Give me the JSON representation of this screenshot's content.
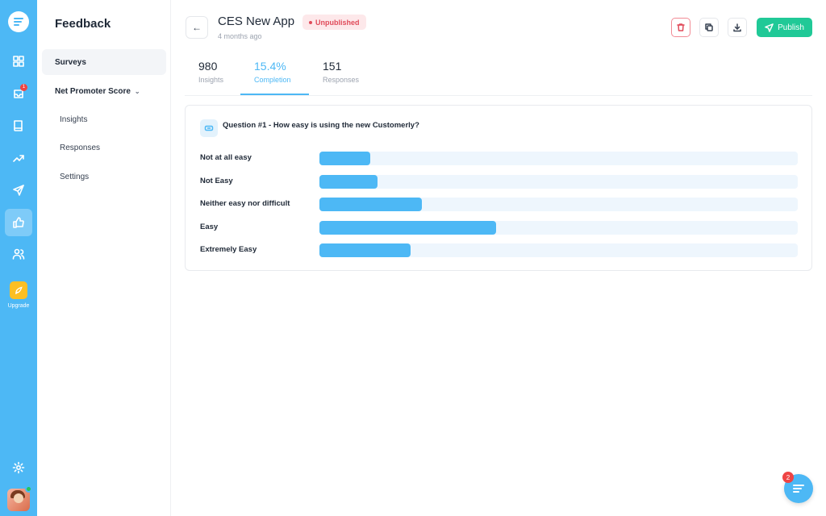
{
  "rail": {
    "items": [
      "dashboard-icon",
      "inbox-icon",
      "book-icon",
      "trending-icon",
      "send-icon",
      "thumbs-up-icon",
      "users-icon"
    ],
    "inbox_badge": "1",
    "upgrade_label": "Upgrade",
    "accent_color": "#4db8f5"
  },
  "sidebar": {
    "title": "Feedback",
    "items": [
      {
        "label": "Surveys"
      },
      {
        "label": "Net Promoter Score"
      }
    ],
    "sub_items": [
      {
        "label": "Insights"
      },
      {
        "label": "Responses"
      },
      {
        "label": "Settings"
      }
    ]
  },
  "header": {
    "title": "CES New App",
    "subtitle": "4 months ago",
    "status": "Unpublished",
    "status_color": "#e04b5a",
    "publish_label": "Publish",
    "publish_color": "#20c997"
  },
  "stats": [
    {
      "value": "980",
      "label": "Insights"
    },
    {
      "value": "15.4%",
      "label": "Completion"
    },
    {
      "value": "151",
      "label": "Responses"
    }
  ],
  "question": {
    "text": "Question #1 - How easy is using the new Customerly?",
    "answers": [
      {
        "label": "Not at all easy",
        "share": 0.107
      },
      {
        "label": "Not Easy",
        "share": 0.121
      },
      {
        "label": "Neither easy nor difficult",
        "share": 0.214
      },
      {
        "label": "Easy",
        "share": 0.369
      },
      {
        "label": "Extremely Easy",
        "share": 0.191
      }
    ]
  },
  "chat": {
    "badge": "2"
  }
}
